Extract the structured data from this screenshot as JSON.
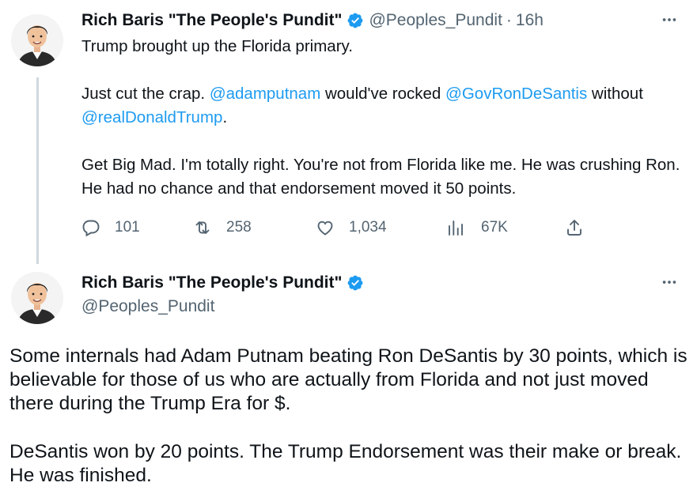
{
  "tweet1": {
    "author_name": "Rich Baris \"The People's Pundit\"",
    "handle": "@Peoples_Pundit",
    "separator": "·",
    "time": "16h",
    "paragraph1": "Trump brought up the Florida primary.",
    "p2_part1": "Just cut the crap. ",
    "p2_mention1": "@adamputnam",
    "p2_part2": " would've rocked ",
    "p2_mention2": "@GovRonDeSantis",
    "p2_part3": " without ",
    "p2_mention3": "@realDonaldTrump",
    "p2_part4": ".",
    "paragraph3": "Get Big Mad. I'm totally right. You're not from Florida like me. He was crushing Ron. He had no chance and that endorsement moved it 50 points.",
    "replies": "101",
    "retweets": "258",
    "likes": "1,034",
    "views": "67K"
  },
  "tweet2": {
    "author_name": "Rich Baris \"The People's Pundit\"",
    "handle": "@Peoples_Pundit",
    "paragraph1": "Some internals had Adam Putnam beating Ron DeSantis by 30 points, which is believable for those of us who are actually from Florida and not just moved there during the Trump Era for $.",
    "paragraph2": "DeSantis won by 20 points. The Trump Endorsement was their make or break. He was finished."
  },
  "icons": {
    "verified": "verified-badge-icon",
    "more": "more-horizontal-icon",
    "reply": "reply-icon",
    "retweet": "retweet-icon",
    "like": "heart-icon",
    "views": "views-chart-icon",
    "share": "share-icon"
  },
  "colors": {
    "link": "#1d9bf0",
    "verified": "#1d9bf0",
    "secondary_text": "#536471",
    "thread_line": "#cfd9de",
    "text": "#0f1419"
  }
}
